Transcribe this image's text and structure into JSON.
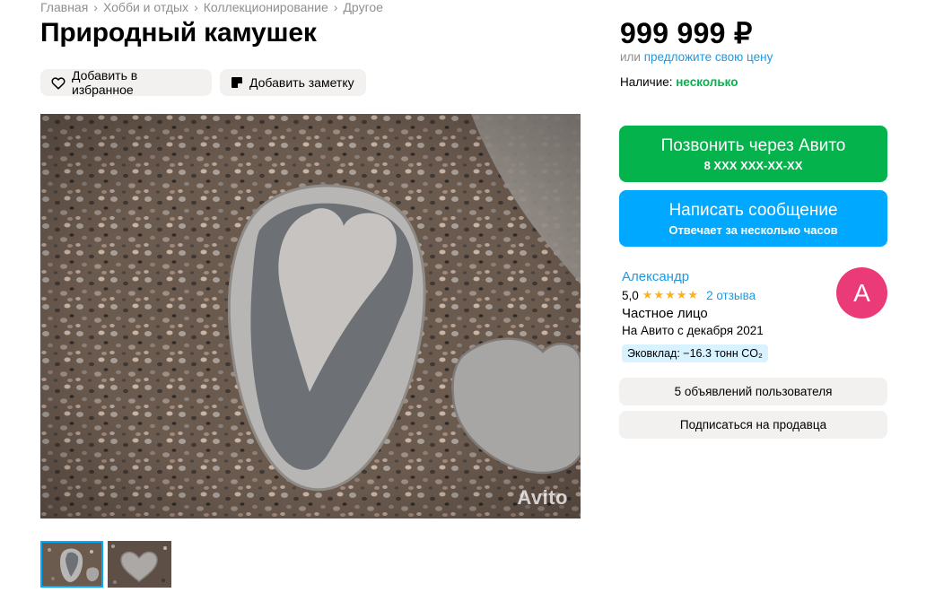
{
  "breadcrumb": [
    "Главная",
    "Хобби и отдых",
    "Коллекционирование",
    "Другое"
  ],
  "title": "Природный камушек",
  "actions": {
    "favorite_label": "Добавить в избранное",
    "note_label": "Добавить заметку"
  },
  "gallery": {
    "watermark": "Avito",
    "thumb_count": 2,
    "active_thumb": 1
  },
  "price": {
    "amount": "999 999 ₽",
    "offer_prefix": "или",
    "offer_link": "предложите свою цену"
  },
  "availability": {
    "label": "Наличие:",
    "value": "несколько"
  },
  "call_button": {
    "label": "Позвонить через Авито",
    "phone": "8 XXX XXX-XX-XX",
    "color": "#04b34b"
  },
  "message_button": {
    "label": "Написать сообщение",
    "subtitle": "Отвечает за несколько часов",
    "color": "#00a8ff"
  },
  "seller": {
    "name": "Александр",
    "rating": "5,0",
    "stars": "★★★★★",
    "reviews": "2 отзыва",
    "type": "Частное лицо",
    "since": "На Авито с декабря 2021",
    "eco": "Эковклад: −16.3 тонн CO₂",
    "avatar_letter": "А",
    "avatar_color": "#ea3a78"
  },
  "seller_actions": {
    "listings": "5 объявлений пользователя",
    "subscribe": "Подписаться на продавца"
  },
  "colors": {
    "link": "#1a9be5",
    "muted": "#8f8f8f",
    "chip_bg": "#f2f1f0"
  }
}
